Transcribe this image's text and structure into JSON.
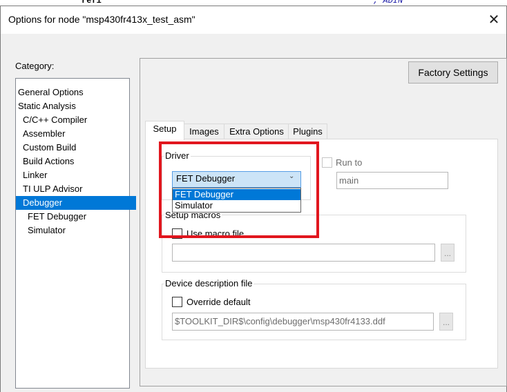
{
  "background": {
    "code_left": "refi",
    "code_right": "; ADIN"
  },
  "window": {
    "title": "Options for node \"msp430fr413x_test_asm\"",
    "close_glyph": "✕"
  },
  "category": {
    "label": "Category:",
    "items": [
      {
        "label": "General Options"
      },
      {
        "label": "Static Analysis"
      },
      {
        "label": "C/C++ Compiler"
      },
      {
        "label": "Assembler"
      },
      {
        "label": "Custom Build"
      },
      {
        "label": "Build Actions"
      },
      {
        "label": "Linker"
      },
      {
        "label": "TI ULP Advisor"
      },
      {
        "label": "Debugger"
      },
      {
        "label": "FET Debugger"
      },
      {
        "label": "Simulator"
      }
    ],
    "selected": "Debugger"
  },
  "factory_settings_label": "Factory Settings",
  "tabs": [
    {
      "label": "Setup"
    },
    {
      "label": "Images"
    },
    {
      "label": "Extra Options"
    },
    {
      "label": "Plugins"
    }
  ],
  "active_tab": "Setup",
  "driver": {
    "label": "Driver",
    "selected": "FET Debugger",
    "chevron": "⌄",
    "options": [
      {
        "label": "FET Debugger"
      },
      {
        "label": "Simulator"
      }
    ]
  },
  "run_to": {
    "label": "Run to",
    "checked": false,
    "value": "main"
  },
  "setup_macros": {
    "label": "Setup macros",
    "checkbox_label": "Use macro file",
    "checked": false,
    "path": "",
    "browse": "..."
  },
  "device_description": {
    "label": "Device description file",
    "checkbox_label": "Override default",
    "checked": false,
    "path": "$TOOLKIT_DIR$\\config\\debugger\\msp430fr4133.ddf",
    "browse": "..."
  },
  "colors": {
    "highlight": "#e1161e",
    "selection": "#0078d7"
  }
}
